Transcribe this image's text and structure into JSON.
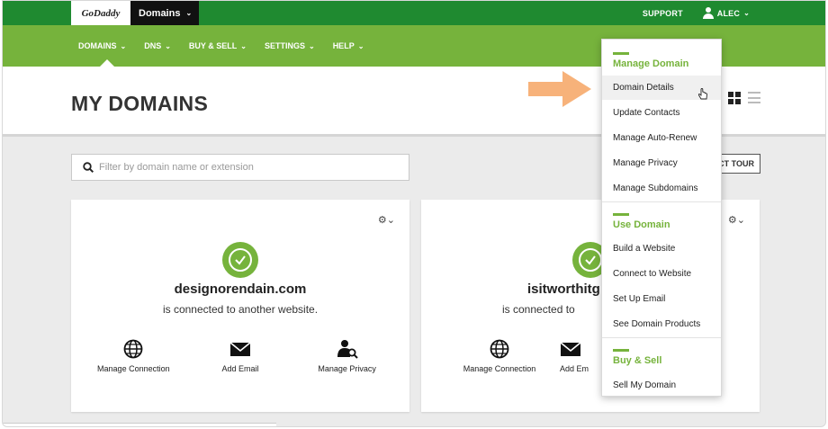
{
  "topbar": {
    "logo_text": "GoDaddy",
    "product_switch": "Domains",
    "support": "SUPPORT",
    "user": "ALEC"
  },
  "nav": {
    "items": [
      {
        "label": "DOMAINS"
      },
      {
        "label": "DNS"
      },
      {
        "label": "BUY & SELL"
      },
      {
        "label": "SETTINGS"
      },
      {
        "label": "HELP"
      }
    ]
  },
  "page": {
    "title": "MY DOMAINS",
    "tour_button": "CT TOUR"
  },
  "search": {
    "placeholder": "Filter by domain name or extension"
  },
  "cards": [
    {
      "domain": "designorendain.com",
      "status": "is connected to another website.",
      "actions": [
        {
          "label": "Manage Connection",
          "icon": "globe-icon"
        },
        {
          "label": "Add Email",
          "icon": "envelope-icon"
        },
        {
          "label": "Manage Privacy",
          "icon": "privacy-user-icon"
        }
      ]
    },
    {
      "domain": "isitworthitg",
      "status": "is connected to",
      "actions": [
        {
          "label": "Manage Connection",
          "icon": "globe-icon"
        },
        {
          "label": "Add Em",
          "icon": "envelope-icon"
        }
      ]
    }
  ],
  "menu": {
    "groups": [
      {
        "title": "Manage Domain",
        "items": [
          "Domain Details",
          "Update Contacts",
          "Manage Auto-Renew",
          "Manage Privacy",
          "Manage Subdomains"
        ]
      },
      {
        "title": "Use Domain",
        "items": [
          "Build a Website",
          "Connect to Website",
          "Set Up Email",
          "See Domain Products"
        ]
      },
      {
        "title": "Buy & Sell",
        "items": [
          "Sell My Domain"
        ]
      }
    ],
    "hovered_item": "Domain Details"
  },
  "colors": {
    "topbar": "#1f8a30",
    "navbar": "#76b33c",
    "accent": "#76b33c",
    "arrow": "#f7b27a"
  }
}
